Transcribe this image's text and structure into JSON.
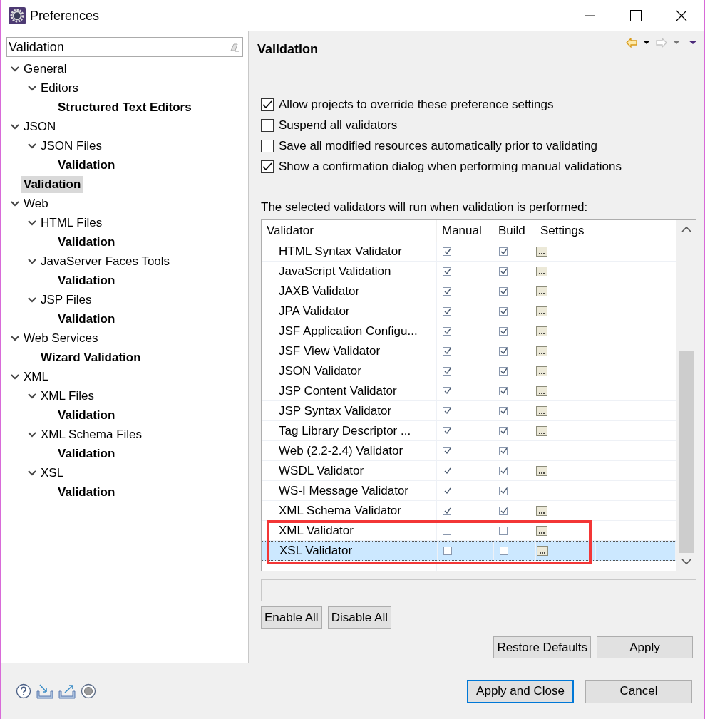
{
  "window": {
    "title": "Preferences"
  },
  "filter": {
    "value": "Validation"
  },
  "tree": [
    {
      "label": "General",
      "expanded": true,
      "matched": false,
      "selected": false,
      "children": [
        {
          "label": "Editors",
          "expanded": true,
          "matched": false,
          "selected": false,
          "children": [
            {
              "label": "Structured Text Editors",
              "matched": true,
              "selected": false
            }
          ]
        }
      ]
    },
    {
      "label": "JSON",
      "expanded": true,
      "matched": false,
      "selected": false,
      "children": [
        {
          "label": "JSON Files",
          "expanded": true,
          "matched": false,
          "selected": false,
          "children": [
            {
              "label": "Validation",
              "matched": true,
              "selected": false
            }
          ]
        }
      ]
    },
    {
      "label": "Validation",
      "matched": true,
      "selected": true
    },
    {
      "label": "Web",
      "expanded": true,
      "matched": false,
      "selected": false,
      "children": [
        {
          "label": "HTML Files",
          "expanded": true,
          "matched": false,
          "selected": false,
          "children": [
            {
              "label": "Validation",
              "matched": true,
              "selected": false
            }
          ]
        },
        {
          "label": "JavaServer Faces Tools",
          "expanded": true,
          "matched": false,
          "selected": false,
          "children": [
            {
              "label": "Validation",
              "matched": true,
              "selected": false
            }
          ]
        },
        {
          "label": "JSP Files",
          "expanded": true,
          "matched": false,
          "selected": false,
          "children": [
            {
              "label": "Validation",
              "matched": true,
              "selected": false
            }
          ]
        }
      ]
    },
    {
      "label": "Web Services",
      "expanded": true,
      "matched": false,
      "selected": false,
      "children": [
        {
          "label": "Wizard Validation",
          "matched": true,
          "selected": false
        }
      ]
    },
    {
      "label": "XML",
      "expanded": true,
      "matched": false,
      "selected": false,
      "children": [
        {
          "label": "XML Files",
          "expanded": true,
          "matched": false,
          "selected": false,
          "children": [
            {
              "label": "Validation",
              "matched": true,
              "selected": false
            }
          ]
        },
        {
          "label": "XML Schema Files",
          "expanded": true,
          "matched": false,
          "selected": false,
          "children": [
            {
              "label": "Validation",
              "matched": true,
              "selected": false
            }
          ]
        },
        {
          "label": "XSL",
          "expanded": true,
          "matched": false,
          "selected": false,
          "children": [
            {
              "label": "Validation",
              "matched": true,
              "selected": false
            }
          ]
        }
      ]
    }
  ],
  "page": {
    "title": "Validation"
  },
  "nav": [
    {
      "kind": "back",
      "disabled": false
    },
    {
      "kind": "forward",
      "disabled": true
    }
  ],
  "options": [
    {
      "label": "Allow projects to override these preference settings",
      "checked": true
    },
    {
      "label": "Suspend all validators",
      "checked": false
    },
    {
      "label": "Save all modified resources automatically prior to validating",
      "checked": false
    },
    {
      "label": "Show a confirmation dialog when performing manual validations",
      "checked": true
    }
  ],
  "validators_label": "The selected validators will run when validation is performed:",
  "table": {
    "columns": [
      "Validator",
      "Manual",
      "Build",
      "Settings"
    ],
    "rows": [
      {
        "name": "HTML Syntax Validator",
        "manual": true,
        "build": true,
        "settings": true,
        "selected": false,
        "highlighted": false
      },
      {
        "name": "JavaScript Validation",
        "manual": true,
        "build": true,
        "settings": true,
        "selected": false,
        "highlighted": false
      },
      {
        "name": "JAXB Validator",
        "manual": true,
        "build": true,
        "settings": true,
        "selected": false,
        "highlighted": false
      },
      {
        "name": "JPA Validator",
        "manual": true,
        "build": true,
        "settings": true,
        "selected": false,
        "highlighted": false
      },
      {
        "name": "JSF Application Configu...",
        "manual": true,
        "build": true,
        "settings": true,
        "selected": false,
        "highlighted": false
      },
      {
        "name": "JSF View Validator",
        "manual": true,
        "build": true,
        "settings": true,
        "selected": false,
        "highlighted": false
      },
      {
        "name": "JSON Validator",
        "manual": true,
        "build": true,
        "settings": true,
        "selected": false,
        "highlighted": false
      },
      {
        "name": "JSP Content Validator",
        "manual": true,
        "build": true,
        "settings": true,
        "selected": false,
        "highlighted": false
      },
      {
        "name": "JSP Syntax Validator",
        "manual": true,
        "build": true,
        "settings": true,
        "selected": false,
        "highlighted": false
      },
      {
        "name": "Tag Library Descriptor ...",
        "manual": true,
        "build": true,
        "settings": true,
        "selected": false,
        "highlighted": false
      },
      {
        "name": "Web (2.2-2.4) Validator",
        "manual": true,
        "build": true,
        "settings": false,
        "selected": false,
        "highlighted": false
      },
      {
        "name": "WSDL Validator",
        "manual": true,
        "build": true,
        "settings": true,
        "selected": false,
        "highlighted": false
      },
      {
        "name": "WS-I Message Validator",
        "manual": true,
        "build": true,
        "settings": false,
        "selected": false,
        "highlighted": false
      },
      {
        "name": "XML Schema Validator",
        "manual": true,
        "build": true,
        "settings": true,
        "selected": false,
        "highlighted": false
      },
      {
        "name": "XML Validator",
        "manual": false,
        "build": false,
        "settings": true,
        "selected": false,
        "highlighted": true
      },
      {
        "name": "XSL Validator",
        "manual": false,
        "build": false,
        "settings": true,
        "selected": true,
        "highlighted": true
      }
    ]
  },
  "table_buttons": [
    "Enable All",
    "Disable All"
  ],
  "page_buttons": [
    "Restore Defaults",
    "Apply"
  ],
  "dialog_buttons": [
    {
      "label": "Apply and Close",
      "default": true
    },
    {
      "label": "Cancel",
      "default": false
    }
  ]
}
